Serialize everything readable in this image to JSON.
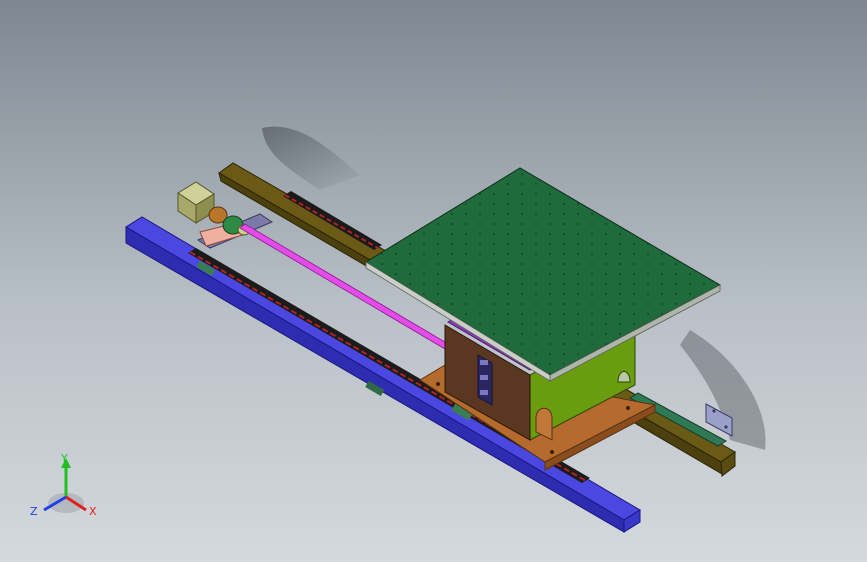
{
  "viewport": {
    "background_top": "#7e8790",
    "background_bottom": "#d4d9dd"
  },
  "model": {
    "components": [
      "blue-rail",
      "olive-rail",
      "stepper-motor",
      "coupling",
      "lead-screw",
      "carriage-block",
      "green-table",
      "orange-base-plate",
      "linear-guides"
    ],
    "colors": {
      "blue_rail": "#3d3ccf",
      "olive_rail": "#6b5a16",
      "table": "#1f6b3c",
      "lead_screw": "#e34ce8",
      "carriage_front": "#5a3720",
      "carriage_side": "#6a9c10",
      "base_plate": "#b56a2e",
      "guide_red": "#b22222"
    }
  },
  "triad": {
    "x_label": "X",
    "y_label": "Y",
    "z_label": "Z",
    "x_color": "#e02020",
    "y_color": "#20c020",
    "z_color": "#2040e0"
  }
}
